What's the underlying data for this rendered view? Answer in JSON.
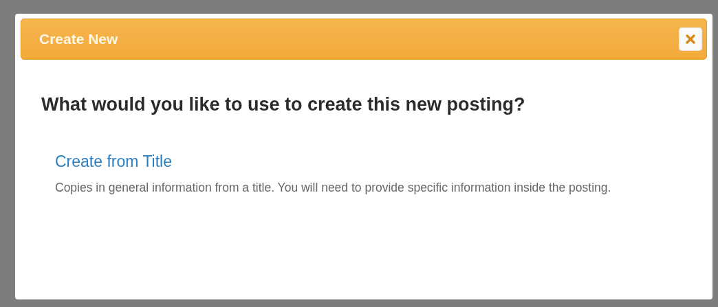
{
  "dialog": {
    "title": "Create New",
    "question": "What would you like to use to create this new posting?",
    "options": [
      {
        "label": "Create from Title",
        "description": "Copies in general information from a title. You will need to provide specific information inside the posting."
      }
    ]
  }
}
